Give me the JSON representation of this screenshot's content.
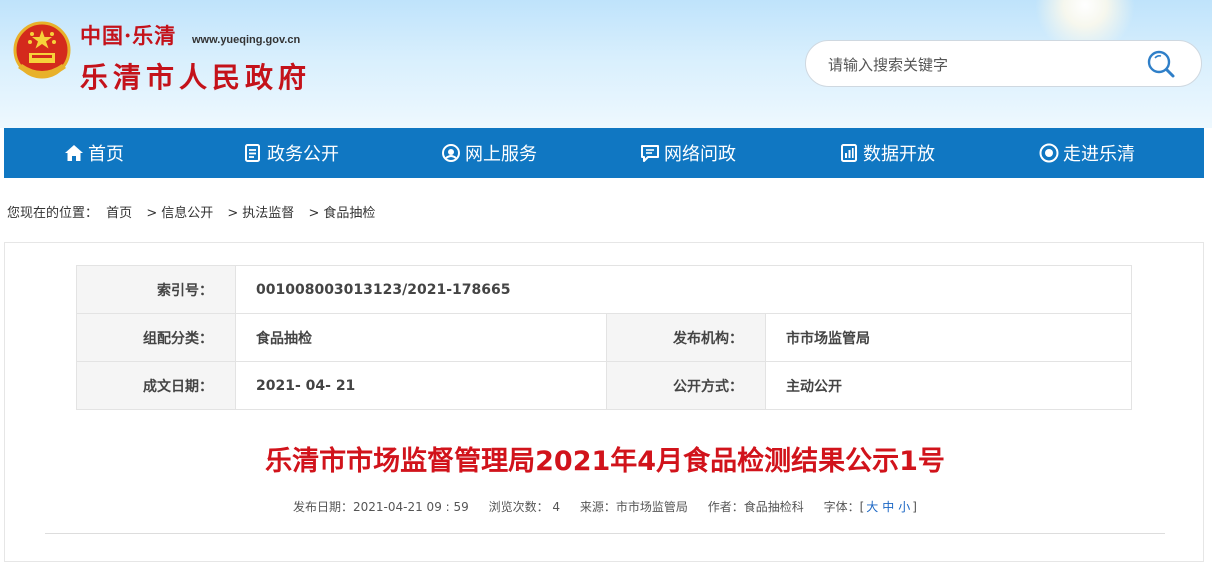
{
  "header": {
    "logo_small": "中国·乐清",
    "logo_url": "www.yueqing.gov.cn",
    "logo_main": "乐清市人民政府",
    "search_placeholder": "请输入搜索关键字"
  },
  "nav": [
    {
      "label": "首页",
      "icon": "home-icon"
    },
    {
      "label": "政务公开",
      "icon": "document-icon"
    },
    {
      "label": "网上服务",
      "icon": "service-icon"
    },
    {
      "label": "网络问政",
      "icon": "chat-icon"
    },
    {
      "label": "数据开放",
      "icon": "data-icon"
    },
    {
      "label": "走进乐清",
      "icon": "eye-icon"
    }
  ],
  "breadcrumb": {
    "prefix": "您现在的位置：",
    "items": [
      "首页",
      "信息公开",
      "执法监督",
      "食品抽检"
    ],
    "separator": ">"
  },
  "info": {
    "index_label": "索引号：",
    "index_value": "001008003013123/2021-178665",
    "category_label": "组配分类：",
    "category_value": "食品抽检",
    "publisher_label": "发布机构：",
    "publisher_value": "市市场监管局",
    "date_label": "成文日期：",
    "date_value": "2021- 04- 21",
    "mode_label": "公开方式：",
    "mode_value": "主动公开"
  },
  "article": {
    "title": "乐清市市场监督管理局2021年4月食品检测结果公示1号",
    "publish_date": "发布日期：2021-04-21 09 : 59",
    "views": "浏览次数： 4",
    "source": "来源：市市场监管局",
    "author": "作者：食品抽检科",
    "font_label": "字体：[",
    "font_large": "大",
    "font_medium": "中",
    "font_small": "小",
    "font_close": "]"
  },
  "colors": {
    "nav_bg": "#1077c2",
    "title_red": "#d1131b",
    "logo_red": "#c4121a",
    "link_blue": "#1a66c4"
  }
}
